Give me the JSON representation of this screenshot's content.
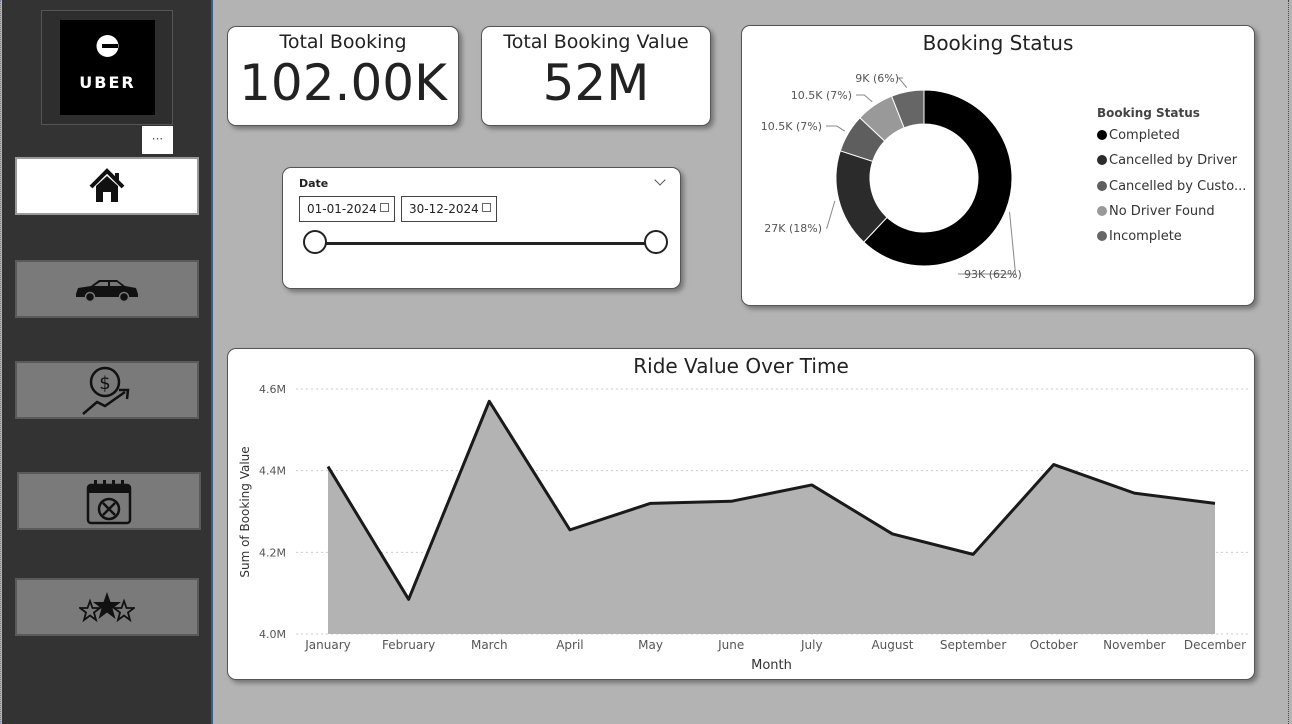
{
  "logo": {
    "text": "UBER"
  },
  "sidebar": {
    "more_label": "···",
    "nav": [
      {
        "icon": "home-icon",
        "active": true
      },
      {
        "icon": "car-icon",
        "active": false
      },
      {
        "icon": "revenue-growth-icon",
        "active": false
      },
      {
        "icon": "calendar-cancel-icon",
        "active": false
      },
      {
        "icon": "star-rating-icon",
        "active": false
      }
    ]
  },
  "kpis": {
    "total_booking": {
      "label": "Total Booking",
      "value": "102.00K"
    },
    "total_booking_value": {
      "label": "Total Booking Value",
      "value": "52M"
    }
  },
  "date_slicer": {
    "title": "Date",
    "start": "01-01-2024",
    "end": "30-12-2024"
  },
  "booking_status": {
    "title": "Booking Status",
    "legend_title": "Booking Status",
    "legend": [
      {
        "label": "Completed",
        "color": "#000000"
      },
      {
        "label": "Cancelled by Driver",
        "color": "#2b2b2b"
      },
      {
        "label": "Cancelled by Custo...",
        "color": "#5e5e5e"
      },
      {
        "label": "No Driver Found",
        "color": "#999999"
      },
      {
        "label": "Incomplete",
        "color": "#666666"
      }
    ]
  },
  "ride_value": {
    "title": "Ride Value Over Time",
    "xlabel": "Month",
    "ylabel": "Sum of Booking Value"
  },
  "chart_data": [
    {
      "type": "pie",
      "title": "Booking Status",
      "labels": [
        "Completed",
        "Cancelled by Driver",
        "Cancelled by Customer",
        "No Driver Found",
        "Incomplete"
      ],
      "values": [
        93000,
        27000,
        10500,
        10500,
        9000
      ],
      "percent": [
        62,
        18,
        7,
        7,
        6
      ],
      "data_labels": [
        "93K (62%)",
        "27K (18%)",
        "10.5K (7%)",
        "10.5K (7%)",
        "9K (6%)"
      ],
      "colors": [
        "#000000",
        "#2b2b2b",
        "#5e5e5e",
        "#999999",
        "#666666"
      ],
      "donut": true,
      "legend_position": "right"
    },
    {
      "type": "area",
      "title": "Ride Value Over Time",
      "xlabel": "Month",
      "ylabel": "Sum of Booking Value",
      "categories": [
        "January",
        "February",
        "March",
        "April",
        "May",
        "June",
        "July",
        "August",
        "September",
        "October",
        "November",
        "December"
      ],
      "values": [
        4410000,
        4085000,
        4570000,
        4255000,
        4320000,
        4325000,
        4365000,
        4245000,
        4195000,
        4415000,
        4345000,
        4320000
      ],
      "ylim": [
        4000000,
        4600000
      ],
      "yticks": [
        4000000,
        4200000,
        4400000,
        4600000
      ],
      "ytick_labels": [
        "4.0M",
        "4.2M",
        "4.4M",
        "4.6M"
      ],
      "grid": true,
      "line_color": "#1a1a1a",
      "fill_color": "#b3b3b3"
    }
  ]
}
